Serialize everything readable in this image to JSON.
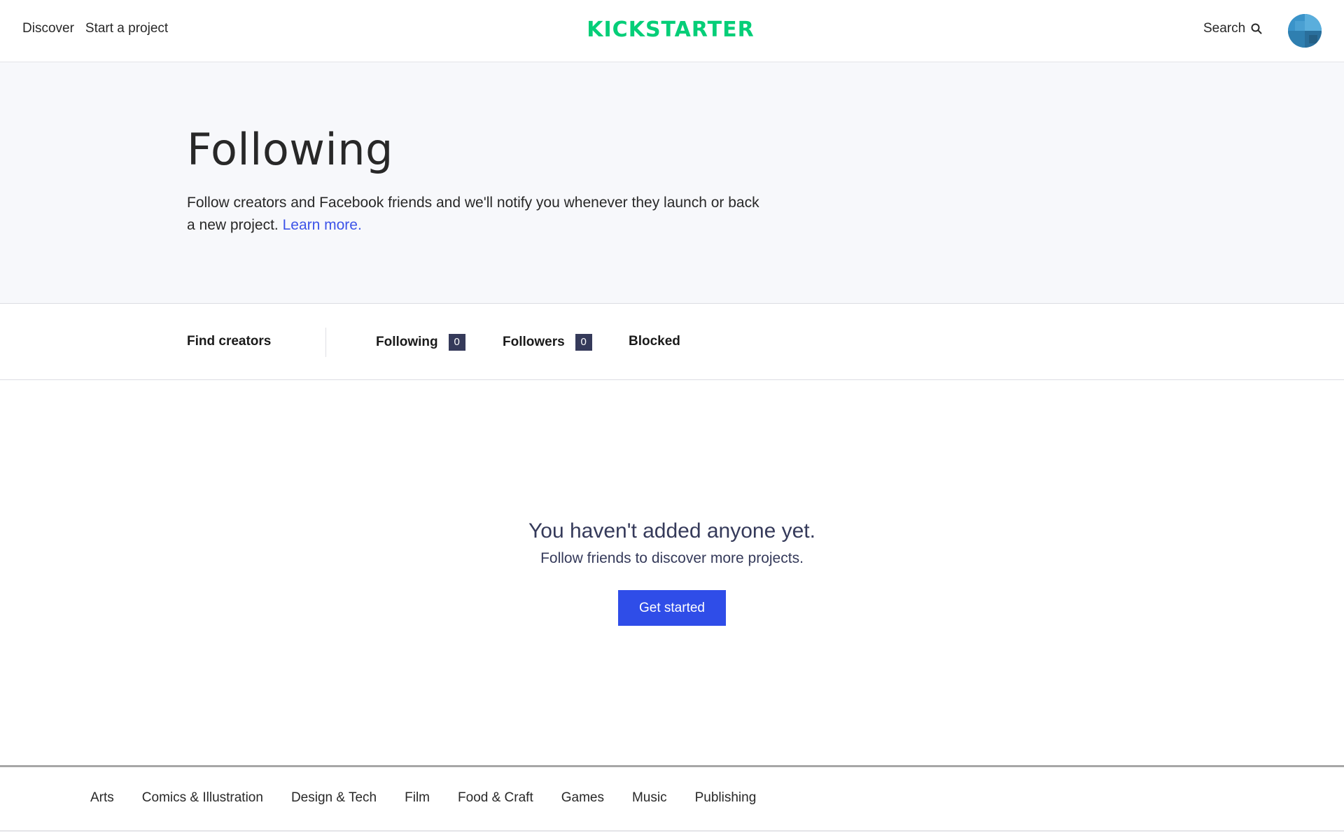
{
  "header": {
    "nav": [
      "Discover",
      "Start a project"
    ],
    "logo": "KICKSTARTER",
    "search_label": "Search",
    "brand_color": "#05ce78"
  },
  "hero": {
    "title": "Following",
    "description": "Follow creators and Facebook friends and we'll notify you whenever they launch or back a new project.",
    "link": "Learn more."
  },
  "tabs": {
    "find": "Find creators",
    "following": {
      "label": "Following",
      "count": "0"
    },
    "followers": {
      "label": "Followers",
      "count": "0"
    },
    "blocked": "Blocked"
  },
  "empty": {
    "title": "You haven't added anyone yet.",
    "subtitle": "Follow friends to discover more projects.",
    "cta": "Get started",
    "cta_color": "#2f4de8"
  },
  "footer": {
    "categories": [
      "Arts",
      "Comics & Illustration",
      "Design & Tech",
      "Film",
      "Food & Craft",
      "Games",
      "Music",
      "Publishing"
    ]
  },
  "icons": {
    "search": "search-icon",
    "avatar": "user-avatar"
  }
}
